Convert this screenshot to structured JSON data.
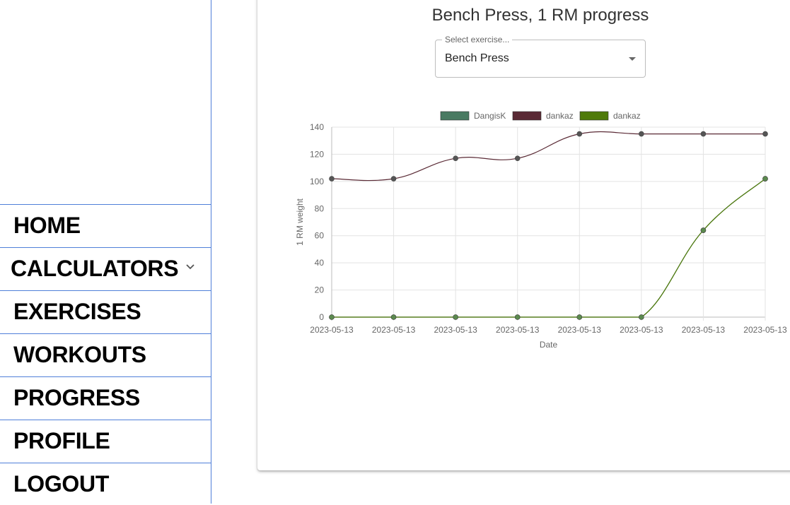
{
  "nav": {
    "items": [
      {
        "label": "HOME"
      },
      {
        "label": "CALCULATORS"
      },
      {
        "label": "EXERCISES"
      },
      {
        "label": "WORKOUTS"
      },
      {
        "label": "PROGRESS"
      },
      {
        "label": "PROFILE"
      },
      {
        "label": "LOGOUT"
      }
    ]
  },
  "main": {
    "title": "Bench Press, 1 RM progress",
    "select": {
      "label": "Select exercise...",
      "value": "Bench Press"
    }
  },
  "chart_data": {
    "type": "line",
    "x": [
      "2023-05-13",
      "2023-05-13",
      "2023-05-13",
      "2023-05-13",
      "2023-05-13",
      "2023-05-13",
      "2023-05-13",
      "2023-05-13"
    ],
    "xlabel": "Date",
    "ylabel": "1 RM weight",
    "ylim": [
      0,
      140
    ],
    "yticks": [
      0,
      20,
      40,
      60,
      80,
      100,
      120,
      140
    ],
    "grid": true,
    "legend_position": "top",
    "series": [
      {
        "name": "DangisK",
        "color": "#4a7a62",
        "point_color": "#5b8a4e",
        "values": [
          0,
          0,
          0,
          0,
          0,
          0,
          64,
          102
        ]
      },
      {
        "name": "dankaz",
        "color": "#5a2a35",
        "point_color": "#555555",
        "values": [
          102,
          102,
          117,
          117,
          135,
          135,
          135,
          135
        ]
      },
      {
        "name": "dankaz",
        "color": "#4f7a0a",
        "point_color": "#5b8a4e",
        "values": [
          0,
          0,
          0,
          0,
          0,
          0,
          64,
          102
        ]
      }
    ]
  }
}
